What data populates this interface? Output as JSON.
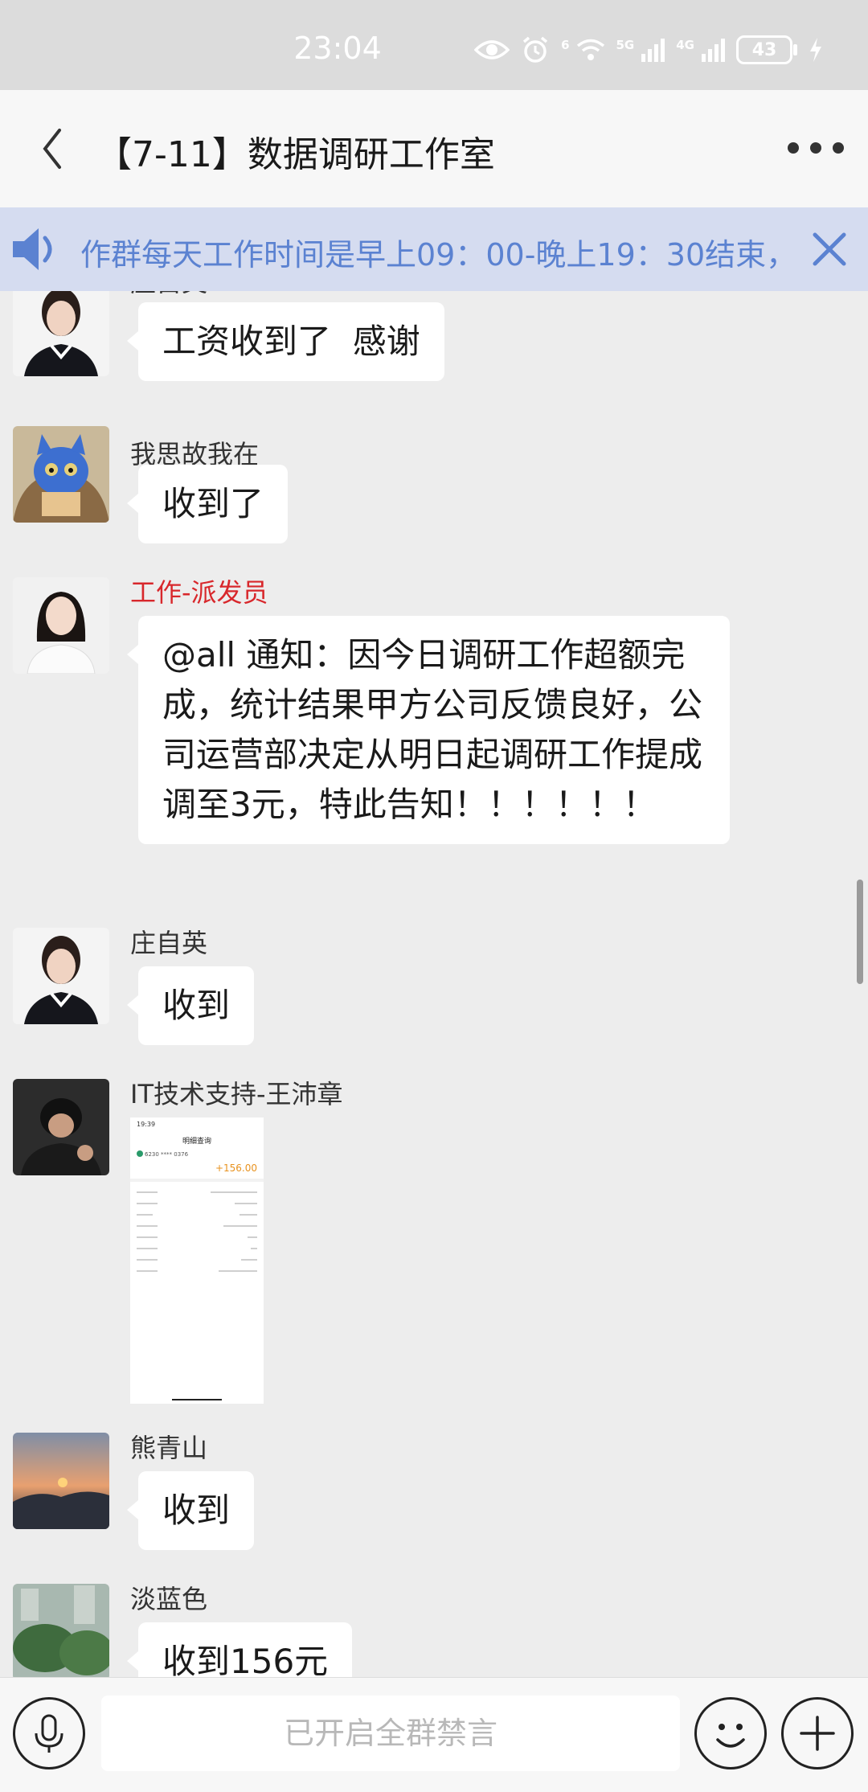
{
  "status_bar": {
    "time": "23:04",
    "battery": "43",
    "network_5g": "5G",
    "network_4g": "4G",
    "wifi_label": "6",
    "icons": [
      "eye-icon",
      "alarm-icon",
      "wifi-icon",
      "signal-icon",
      "signal-icon",
      "battery-icon",
      "charging-icon"
    ]
  },
  "header": {
    "title": "【7-11】数据调研工作室",
    "back_icon": "chevron-left-icon",
    "more_icon": "more-dots-icon"
  },
  "notice": {
    "text": "作群每天工作时间是早上09：00-晚上19：30结束，",
    "icon": "speaker-icon",
    "close_icon": "close-icon"
  },
  "messages": [
    {
      "sender": "庄自英",
      "text": "工资收到了  感谢"
    },
    {
      "sender": "我思故我在",
      "text": "收到了"
    },
    {
      "sender": "工作-派发员",
      "text": "@all 通知：因今日调研工作超额完成，统计结果甲方公司反馈良好，公司运营部决定从明日起调研工作提成调至3元，特此告知！！！！！！"
    },
    {
      "sender": "庄自英",
      "text": "收到"
    },
    {
      "sender": "IT技术支持-王沛章",
      "image": {
        "time": "19:39",
        "title": "明细查询",
        "account": "6230 **** 0376",
        "amount": "+156.00"
      }
    },
    {
      "sender": "熊青山",
      "text": "收到"
    },
    {
      "sender": "淡蓝色",
      "text": "收到156元"
    }
  ],
  "input": {
    "placeholder": "已开启全群禁言",
    "voice_icon": "microphone-icon",
    "emoji_icon": "emoji-icon",
    "plus_icon": "plus-icon"
  },
  "colors": {
    "notice_bg": "#d5dcf0",
    "notice_text": "#5b82d1",
    "red_sender": "#d8272b",
    "chat_bg": "#ededed"
  }
}
